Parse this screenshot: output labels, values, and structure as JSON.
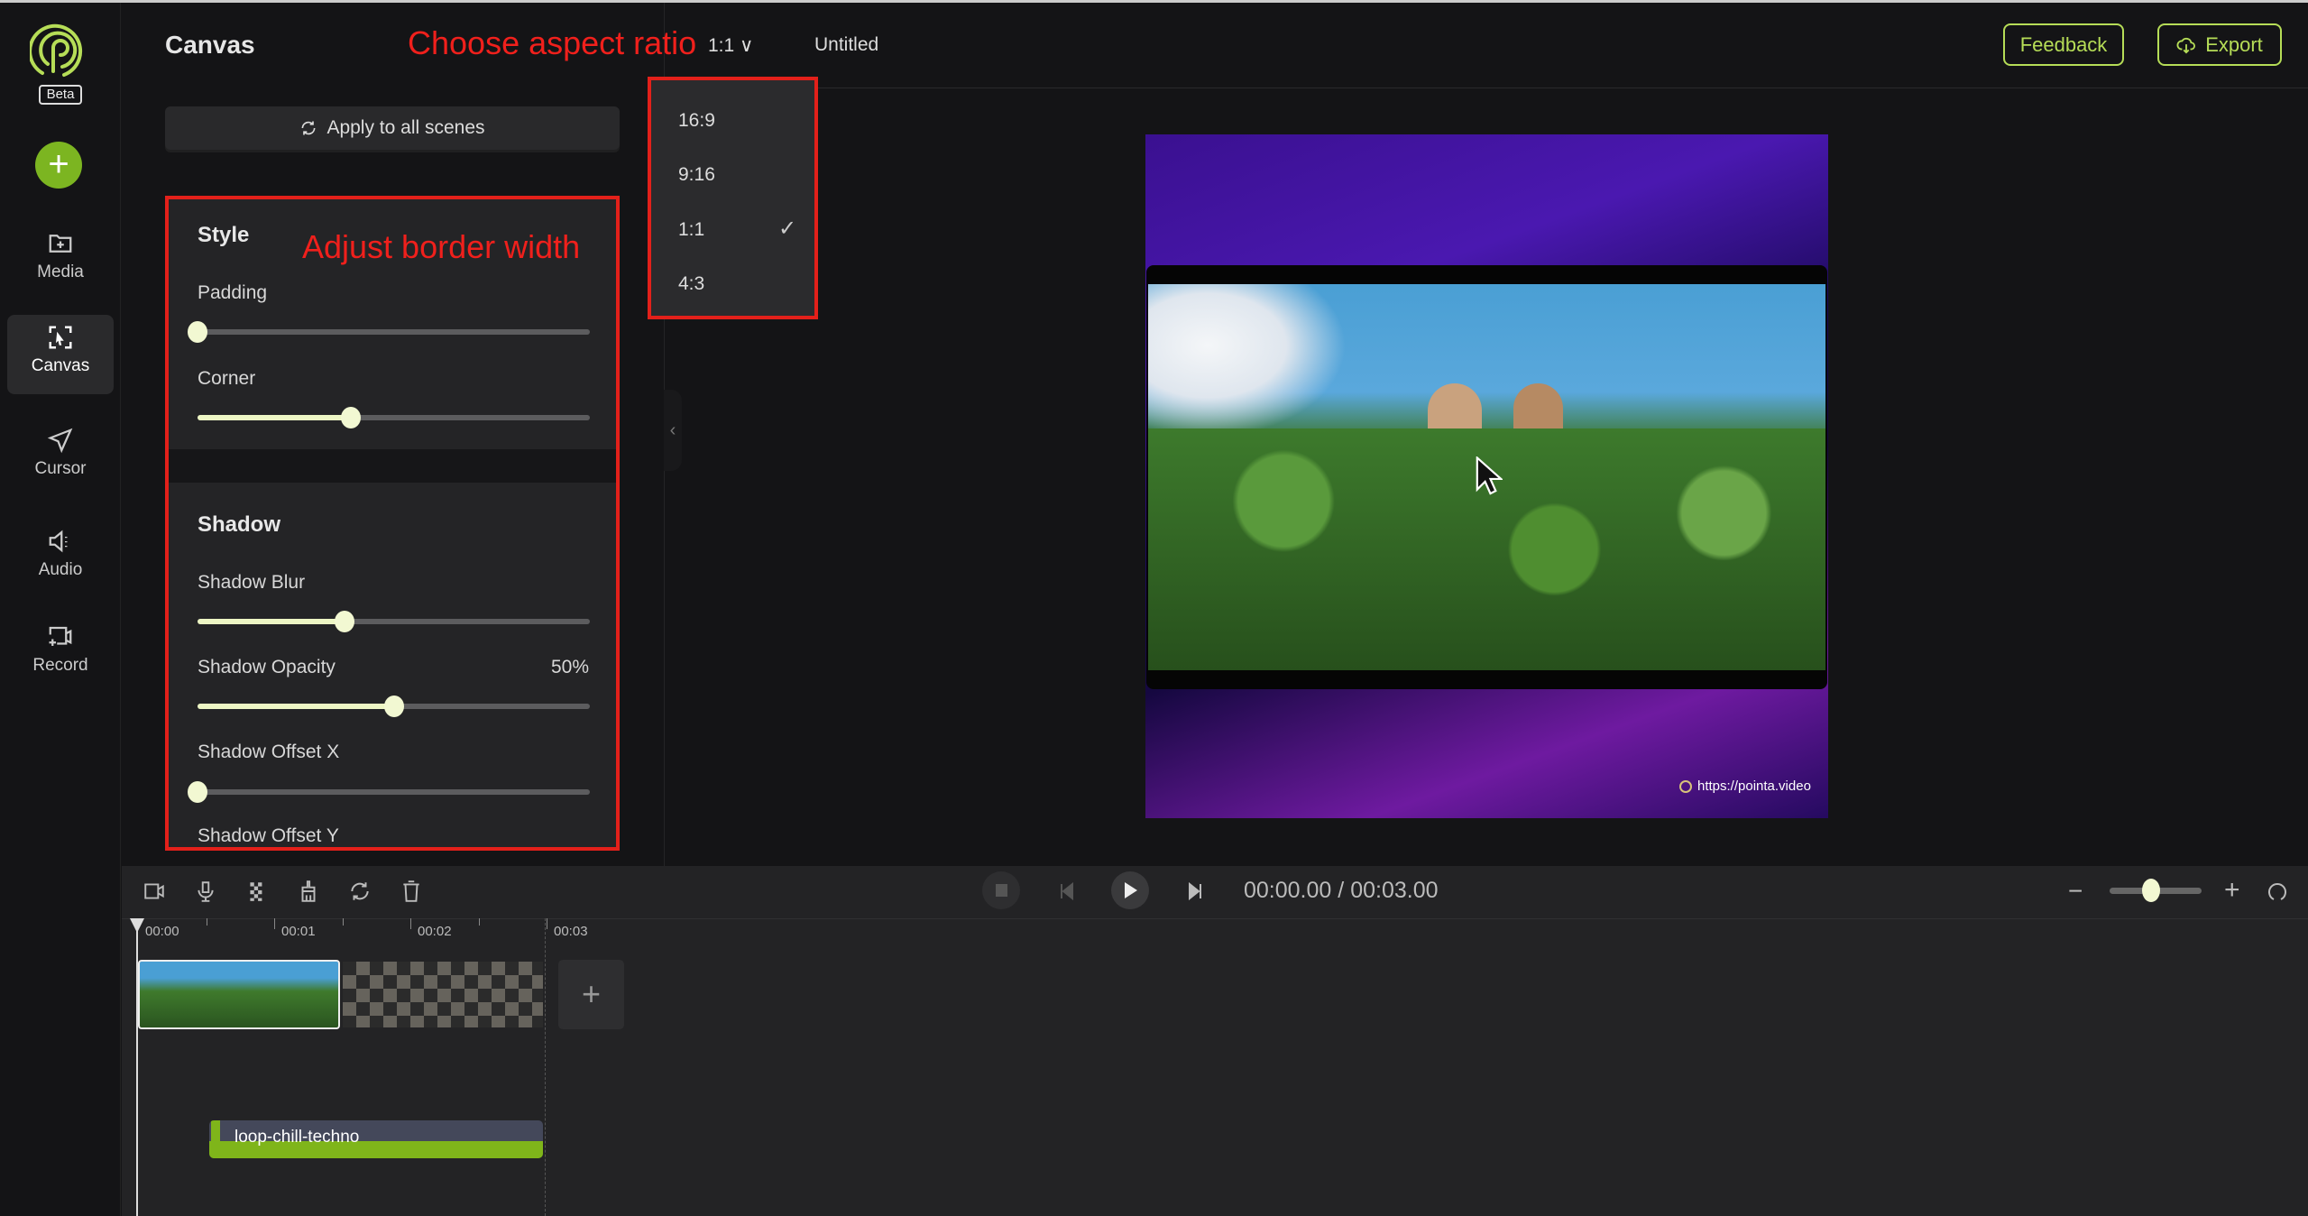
{
  "app": {
    "logo_badge": "Beta",
    "document_title": "Untitled"
  },
  "colors": {
    "accent": "#b6dd57",
    "annotation": "#e3201a",
    "slider_fill": "#edf6c4"
  },
  "sidebar": {
    "add_icon": "plus-icon",
    "items": [
      {
        "label": "Media",
        "icon": "folder-plus-icon"
      },
      {
        "label": "Canvas",
        "icon": "canvas-select-icon",
        "active": true
      },
      {
        "label": "Cursor",
        "icon": "cursor-arrow-icon"
      },
      {
        "label": "Audio",
        "icon": "speaker-icon"
      },
      {
        "label": "Record",
        "icon": "record-screen-icon"
      }
    ]
  },
  "header": {
    "title": "Canvas",
    "aspect_ratio": "1:1",
    "feedback": "Feedback",
    "export": "Export"
  },
  "annotations": {
    "aspect": "Choose aspect ratio",
    "border": "Adjust border width"
  },
  "panel": {
    "apply_all": "Apply to all scenes",
    "style": {
      "title": "Style",
      "sliders": [
        {
          "label": "Padding",
          "value": 0
        },
        {
          "label": "Corner",
          "value": 0.39
        }
      ]
    },
    "shadow": {
      "title": "Shadow",
      "sliders": [
        {
          "label": "Shadow Blur",
          "value": 0.375
        },
        {
          "label": "Shadow Opacity",
          "value": 0.5,
          "display": "50%"
        },
        {
          "label": "Shadow Offset X",
          "value": 0
        },
        {
          "label": "Shadow Offset Y"
        }
      ]
    }
  },
  "aspect_dropdown": {
    "options": [
      "16:9",
      "9:16",
      "1:1",
      "4:3"
    ],
    "selected": "1:1"
  },
  "preview": {
    "watermark": "https://pointa.video"
  },
  "timeline": {
    "tools": [
      "camera-icon",
      "microphone-icon",
      "checker-icon",
      "brush-icon",
      "refresh-icon",
      "trash-icon"
    ],
    "current_time": "00:00.00",
    "separator": "/",
    "total_time": "00:03.00",
    "ruler": [
      "00:00",
      "00:01",
      "00:02",
      "00:03"
    ],
    "zoom_level": 0.45,
    "audio_clip": "loop-chill-techno"
  }
}
